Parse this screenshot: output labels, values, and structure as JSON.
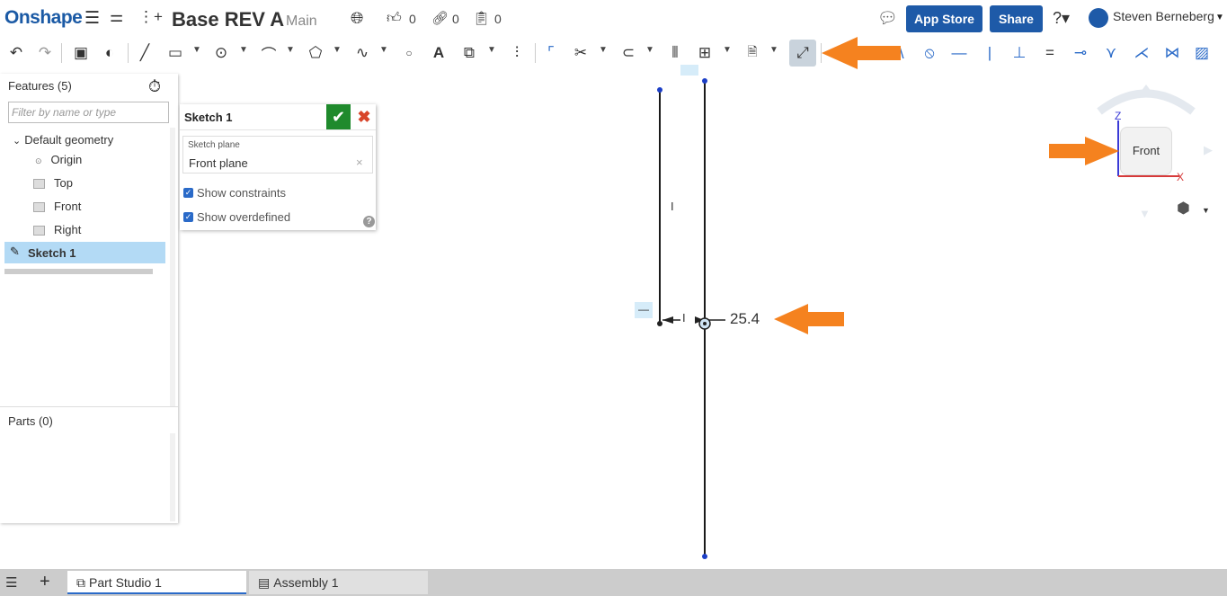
{
  "header": {
    "logo": "Onshape",
    "doc_title": "Base REV A",
    "branch": "Main",
    "likes": "0",
    "links": "0",
    "copies": "0",
    "app_store": "App Store",
    "share": "Share",
    "user_name": "Steven Berneberg"
  },
  "features": {
    "title": "Features (5)",
    "filter_placeholder": "Filter by name or type",
    "default_geometry": "Default geometry",
    "items": [
      "Origin",
      "Top",
      "Front",
      "Right"
    ],
    "sketch": "Sketch 1",
    "parts_title": "Parts (0)"
  },
  "sketch_dialog": {
    "title": "Sketch 1",
    "plane_label": "Sketch plane",
    "plane_value": "Front plane",
    "plane_clear": "×",
    "show_constraints": "Show constraints",
    "show_overdefined": "Show overdefined",
    "help": "?"
  },
  "canvas": {
    "dimension": "25.4",
    "constraint_vertical": "I",
    "constraint_horizontal": "—"
  },
  "view_cube": {
    "face": "Front",
    "axis_z": "Z",
    "axis_x": "X"
  },
  "tabs": [
    "Part Studio 1",
    "Assembly 1"
  ],
  "colors": {
    "brand_blue": "#1e5aa8",
    "annotation_orange": "#f5821f",
    "confirm_green": "#1f8a2c",
    "cancel_red": "#d8452a"
  }
}
